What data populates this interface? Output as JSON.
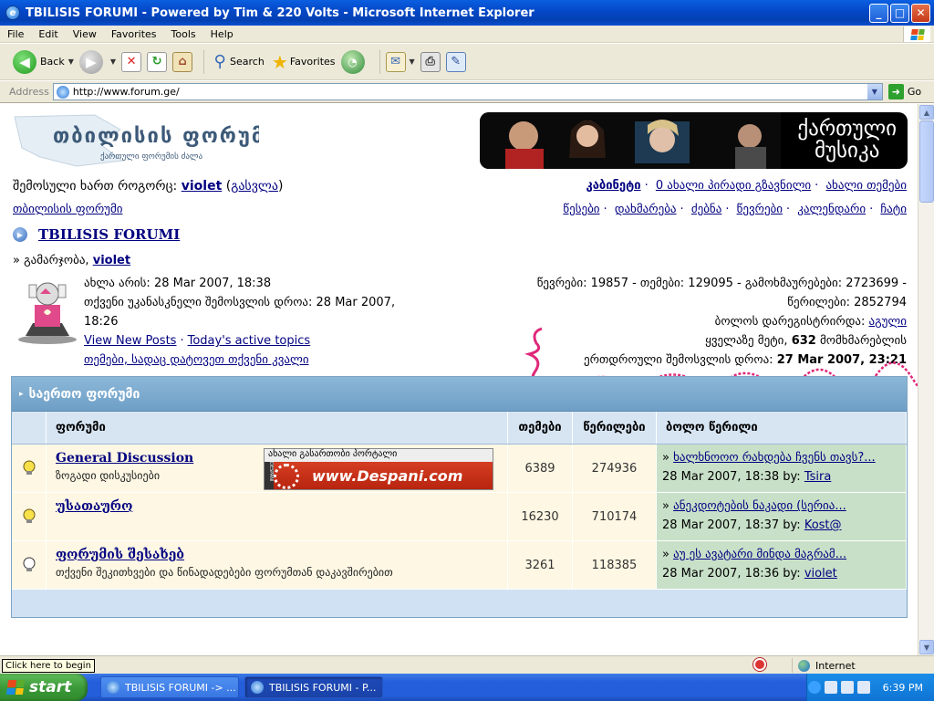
{
  "window": {
    "title": "TBILISIS FORUMI - Powered by Tim & 220 Volts - Microsoft Internet Explorer",
    "minimize": "_",
    "maximize": "□",
    "close": "✕"
  },
  "menu": [
    "File",
    "Edit",
    "View",
    "Favorites",
    "Tools",
    "Help"
  ],
  "toolbar": {
    "back": "Back",
    "search": "Search",
    "favorites": "Favorites"
  },
  "address": {
    "label": "Address",
    "url": "http://www.forum.ge/",
    "go": "Go"
  },
  "page": {
    "logo_title": "თბილისის ფორუმი",
    "logo_subtitle": "ქართული ფორუმის ძალა",
    "banner_text_line1": "ქართული",
    "banner_text_line2": "მუსიკა",
    "logged_in_prefix": "შემოსული ხართ როგორც:",
    "username": "violet",
    "logout": "გასვლა",
    "forum_home": "თბილისის ფორუმი",
    "top_links_1": [
      "კაბინეტი",
      "0 ახალი პირადი გზავნილი",
      "ახალი თემები"
    ],
    "top_links_2": [
      "წესები",
      "დახმარება",
      "ძებნა",
      "წევრები",
      "კალენდარი",
      "ჩატი"
    ],
    "main_title": "TBILISIS FORUMI",
    "greeting_prefix": "» გამარჯობა,",
    "greeting_user": "violet",
    "info_left": {
      "now": "ახლა არის: 28 Mar 2007, 18:38",
      "last_visit_1": "თქვენი უკანასკნელი შემოსვლის დროა: 28 Mar 2007,",
      "last_visit_2": "18:26",
      "view_new_posts": "View New Posts",
      "todays_topics": "Today's active topics",
      "my_topics": "თემები, სადაც დატოვეთ თქვენი კვალი"
    },
    "info_right": {
      "stats_1": "წევრები: 19857 - თემები: 129095 - გამოხმაურებები: 2723699 -",
      "stats_2": "წერილები: 2852794",
      "last_registered_prefix": "ბოლოს დარეგისტრირდა:",
      "last_registered_user": "აგული",
      "max_prefix": "ყველაზე მეტი,",
      "max_count": "632",
      "max_suffix": "მომხმარებლის",
      "online_prefix": "ერთდროული შემოსვლის დროა:",
      "online_date": "27 Mar 2007, 23:21"
    }
  },
  "forum_table": {
    "category": "საერთო ფორუმი",
    "headers": {
      "forum": "ფორუმი",
      "topics": "თემები",
      "posts": "წერილები",
      "last": "ბოლო წერილი"
    },
    "rows": [
      {
        "name": "General Discussion",
        "desc": "ზოგადი დისკუსიები",
        "topics": "6389",
        "posts": "274936",
        "last_title": "ხალხნოოო რახდება ჩვენს თავს?...",
        "last_date": "28 Mar 2007, 18:38 by:",
        "last_user": "Tsira",
        "ad_top": "ახალი გასართობი პორტალი",
        "ad_text": "www.Despani.com",
        "ad_side": "DESPANI"
      },
      {
        "name": "უსათაურო",
        "desc": "",
        "topics": "16230",
        "posts": "710174",
        "last_title": "ანეკდოტების ნაკადი (სერია...",
        "last_date": "28 Mar 2007, 18:37 by:",
        "last_user": "Kost@"
      },
      {
        "name": "ფორუმის შესახებ",
        "desc": "თქვენი შეკითხვები და წინადადებები ფორუმთან დაკავშირებით",
        "topics": "3261",
        "posts": "118385",
        "last_title": "აუ ეს ავატარი მინდა მაგრამ...",
        "last_date": "28 Mar 2007, 18:36 by:",
        "last_user": "violet"
      }
    ]
  },
  "status": {
    "tooltip": "Click here to begin",
    "zone": "Internet"
  },
  "taskbar": {
    "start": "start",
    "tasks": [
      "TBILISIS FORUMI -> ...",
      "TBILISIS FORUMI - P..."
    ],
    "clock": "6:39 PM"
  },
  "colors": {
    "link": "#000080",
    "titlebar": "#0447c6",
    "category_header": "#6f9fc6",
    "row_bg": "#fdf7e3",
    "last_post_bg": "#c8e0c8",
    "scribble": "#e0287a"
  }
}
